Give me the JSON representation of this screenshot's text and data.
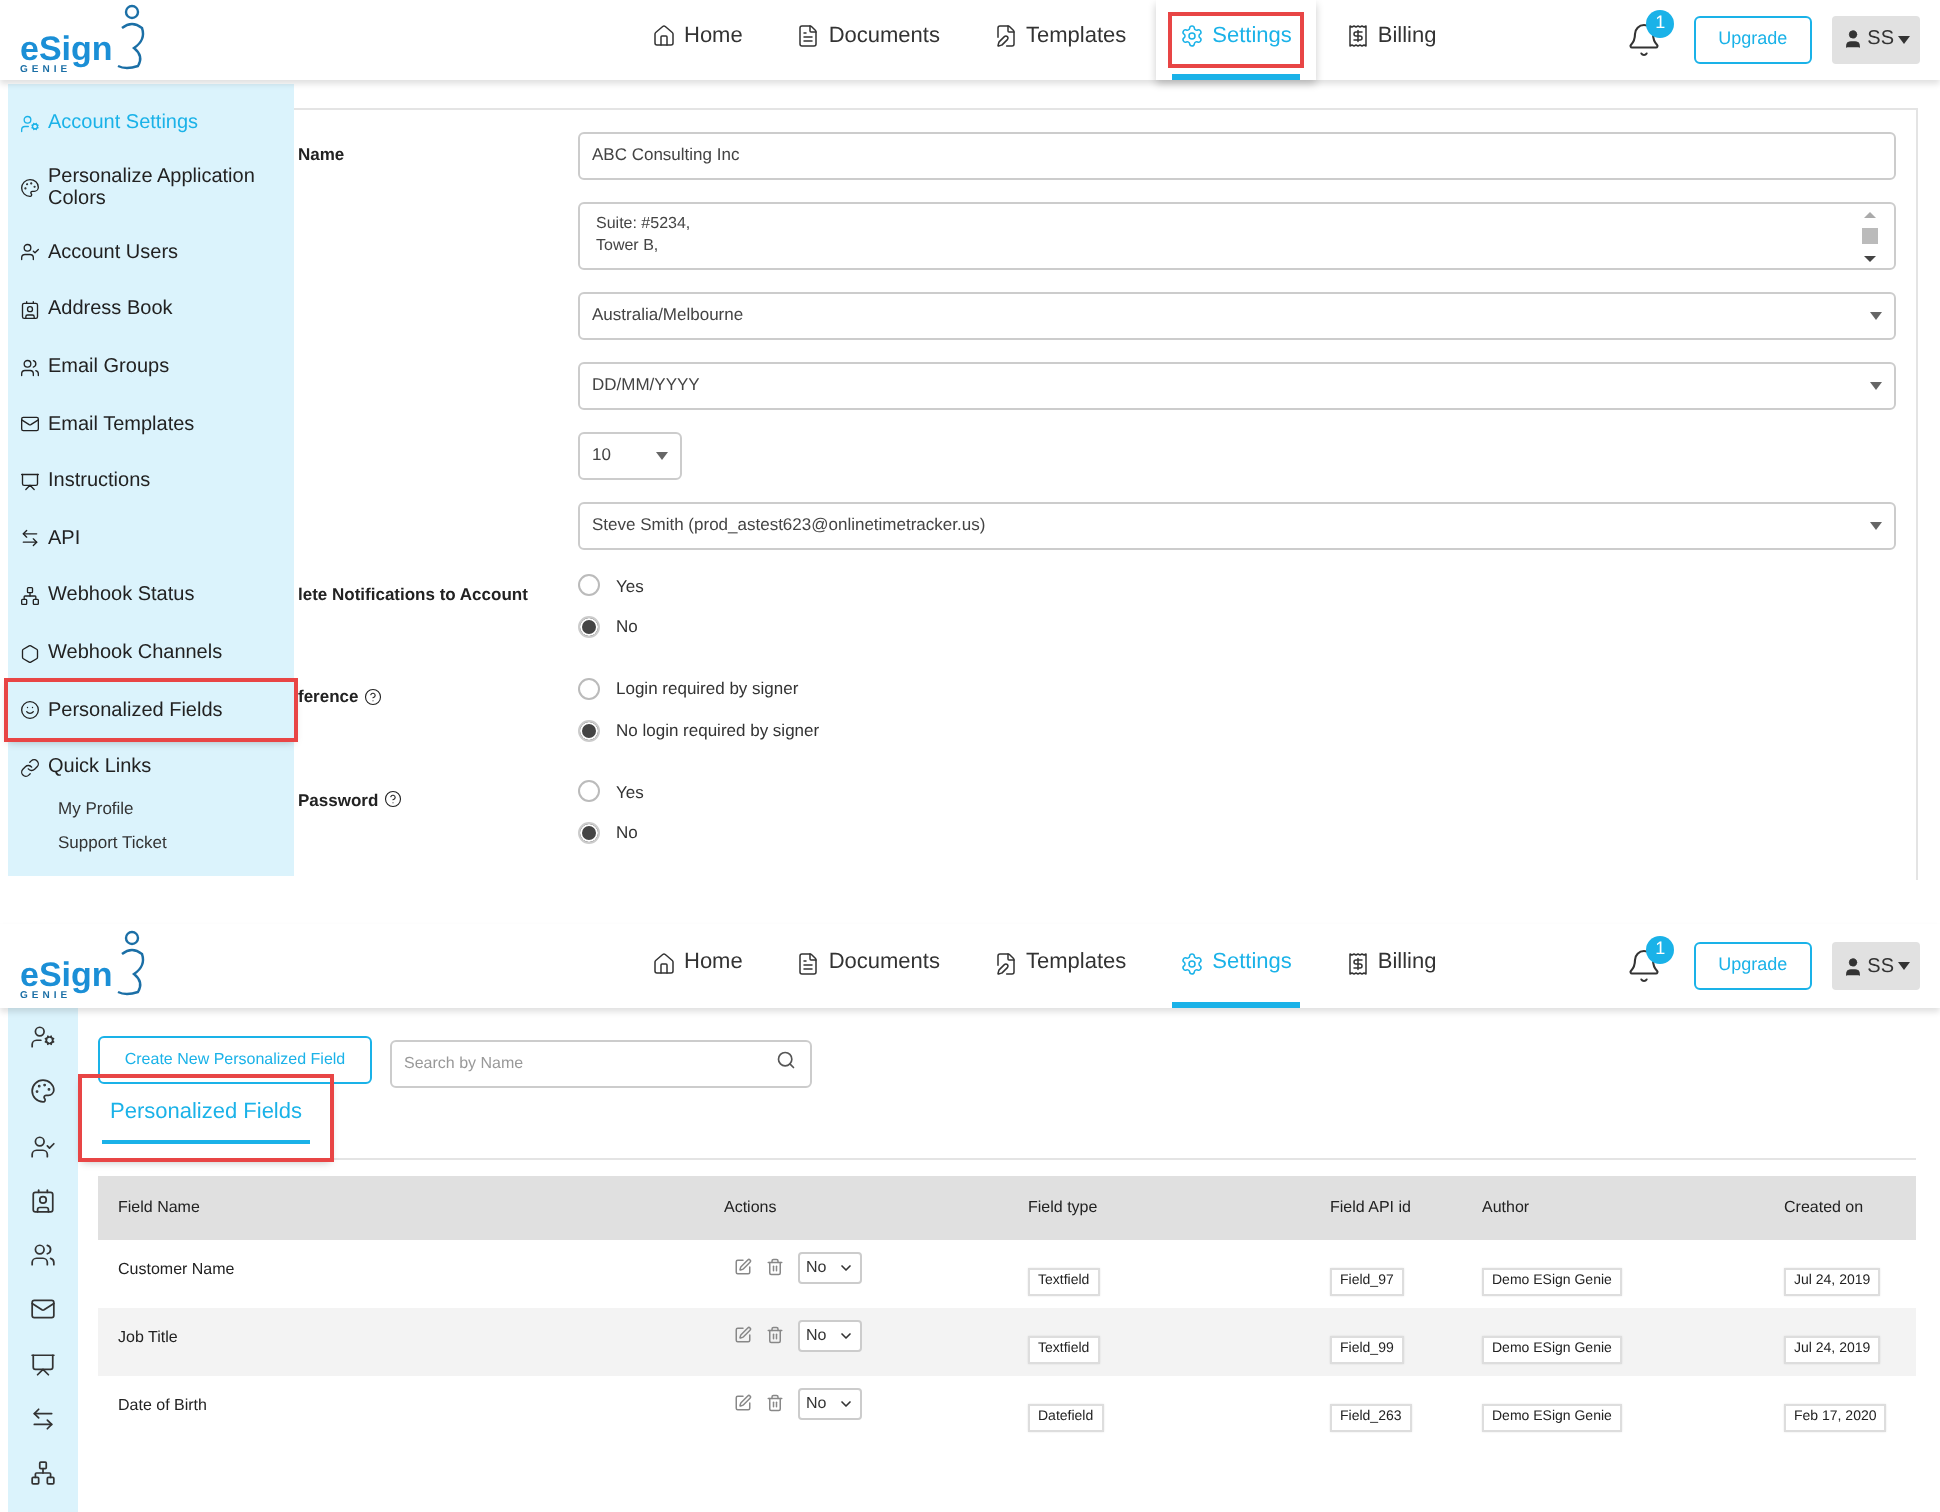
{
  "top": {
    "header": {
      "logo": {
        "word": "eSign",
        "sub": "GENIE"
      },
      "nav": [
        {
          "label": "Home",
          "selected": false,
          "annotated": false
        },
        {
          "label": "Documents",
          "selected": false,
          "annotated": false
        },
        {
          "label": "Templates",
          "selected": false,
          "annotated": false
        },
        {
          "label": "Settings",
          "selected": true,
          "annotated": true
        },
        {
          "label": "Billing",
          "selected": false,
          "annotated": false
        }
      ],
      "notifications": "1",
      "upgrade": "Upgrade",
      "user": "SS"
    },
    "sidebar": {
      "items": [
        {
          "label": "Account Settings",
          "selected": true,
          "annotated": false
        },
        {
          "label": "Personalize Application Colors",
          "selected": false,
          "annotated": false
        },
        {
          "label": "Account Users",
          "selected": false,
          "annotated": false
        },
        {
          "label": "Address Book",
          "selected": false,
          "annotated": false
        },
        {
          "label": "Email Groups",
          "selected": false,
          "annotated": false
        },
        {
          "label": "Email Templates",
          "selected": false,
          "annotated": false
        },
        {
          "label": "Instructions",
          "selected": false,
          "annotated": false
        },
        {
          "label": "API",
          "selected": false,
          "annotated": false
        },
        {
          "label": "Webhook Status",
          "selected": false,
          "annotated": false
        },
        {
          "label": "Webhook Channels",
          "selected": false,
          "annotated": false
        },
        {
          "label": "Personalized Fields",
          "selected": false,
          "annotated": true
        },
        {
          "label": "Quick Links",
          "selected": false,
          "annotated": false,
          "children": [
            {
              "label": "My Profile"
            },
            {
              "label": "Support Ticket"
            }
          ]
        }
      ]
    },
    "form": {
      "rows": [
        {
          "kind": "text",
          "label": "Name",
          "value": "ABC Consulting Inc"
        },
        {
          "kind": "textarea",
          "lines": [
            "Suite: #5234,",
            "Tower B,"
          ]
        },
        {
          "kind": "select",
          "value": "Australia/Melbourne"
        },
        {
          "kind": "select",
          "value": "DD/MM/YYYY"
        },
        {
          "kind": "select_small",
          "value": "10"
        },
        {
          "kind": "select",
          "value": "Steve Smith (prod_astest623@onlinetimetracker.us)"
        },
        {
          "kind": "radio",
          "label": "lete Notifications to Account",
          "help": false,
          "options": [
            {
              "label": "Yes",
              "selected": false
            },
            {
              "label": "No",
              "selected": true
            }
          ]
        },
        {
          "kind": "radio",
          "label": "ference",
          "help": true,
          "options": [
            {
              "label": "Login required by signer",
              "selected": false
            },
            {
              "label": "No login required by signer",
              "selected": true
            }
          ]
        },
        {
          "kind": "radio",
          "label": "Password",
          "help": true,
          "options": [
            {
              "label": "Yes",
              "selected": false
            },
            {
              "label": "No",
              "selected": true
            }
          ]
        }
      ]
    }
  },
  "bottom": {
    "header": {
      "logo": {
        "word": "eSign",
        "sub": "GENIE"
      },
      "nav": [
        {
          "label": "Home",
          "selected": false,
          "annotated": false
        },
        {
          "label": "Documents",
          "selected": false,
          "annotated": false
        },
        {
          "label": "Templates",
          "selected": false,
          "annotated": false
        },
        {
          "label": "Settings",
          "selected": true,
          "annotated": false
        },
        {
          "label": "Billing",
          "selected": false,
          "annotated": false
        }
      ],
      "notifications": "1",
      "upgrade": "Upgrade",
      "user": "SS"
    },
    "create_button": "Create New Personalized Field",
    "search": {
      "placeholder": "Search by Name"
    },
    "tabs": [
      {
        "label": "Personalized Fields",
        "selected": true,
        "annotated": true
      }
    ],
    "table": {
      "columns": [
        "Field Name",
        "Actions",
        "Field type",
        "Field API id",
        "Author",
        "Created on"
      ],
      "rows": [
        {
          "field_name": "Customer Name",
          "required": "No",
          "field_type": "Textfield",
          "api_id": "Field_97",
          "author": "Demo ESign Genie",
          "created_on": "Jul 24, 2019"
        },
        {
          "field_name": "Job Title",
          "required": "No",
          "field_type": "Textfield",
          "api_id": "Field_99",
          "author": "Demo ESign Genie",
          "created_on": "Jul 24, 2019"
        },
        {
          "field_name": "Date of Birth",
          "required": "No",
          "field_type": "Datefield",
          "api_id": "Field_263",
          "author": "Demo ESign Genie",
          "created_on": "Feb 17, 2020"
        }
      ]
    }
  }
}
